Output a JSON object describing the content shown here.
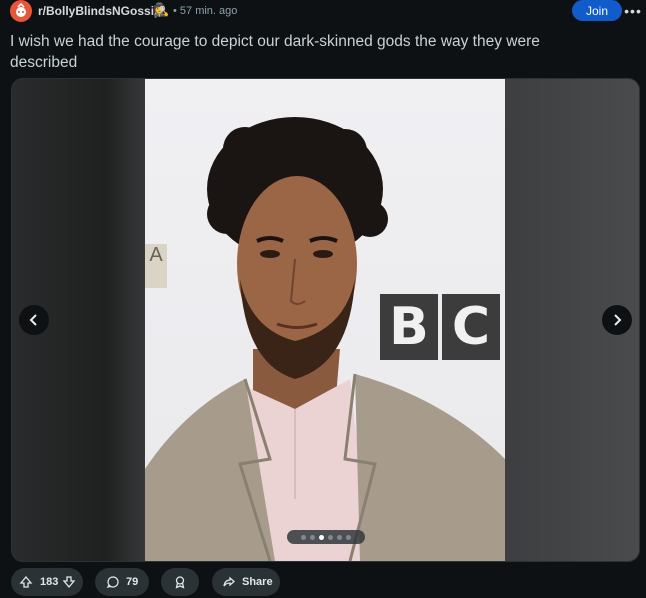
{
  "header": {
    "subreddit": "r/BollyBlindsNGossip",
    "user_flair_icon": "🕵",
    "time": "• 57 min. ago",
    "join_label": "Join",
    "more_label": "•••"
  },
  "post": {
    "title": "I wish we had the courage to depict our dark-skinned gods the way they were described"
  },
  "gallery": {
    "image_alt": "Photo of a man with curly dark hair wearing a beige suit jacket and light pink shirt in front of a BBC backdrop",
    "backdrop_letters": [
      "B",
      "C"
    ],
    "side_sign": "A",
    "slide_count": 6,
    "active_slide": 3
  },
  "actions": {
    "upvotes": "183",
    "comments": "79",
    "share_label": "Share"
  },
  "colors": {
    "background": "#0e1113",
    "join_button": "#115bca",
    "subreddit_avatar": "#e8563a",
    "pill": "#2a3236"
  }
}
